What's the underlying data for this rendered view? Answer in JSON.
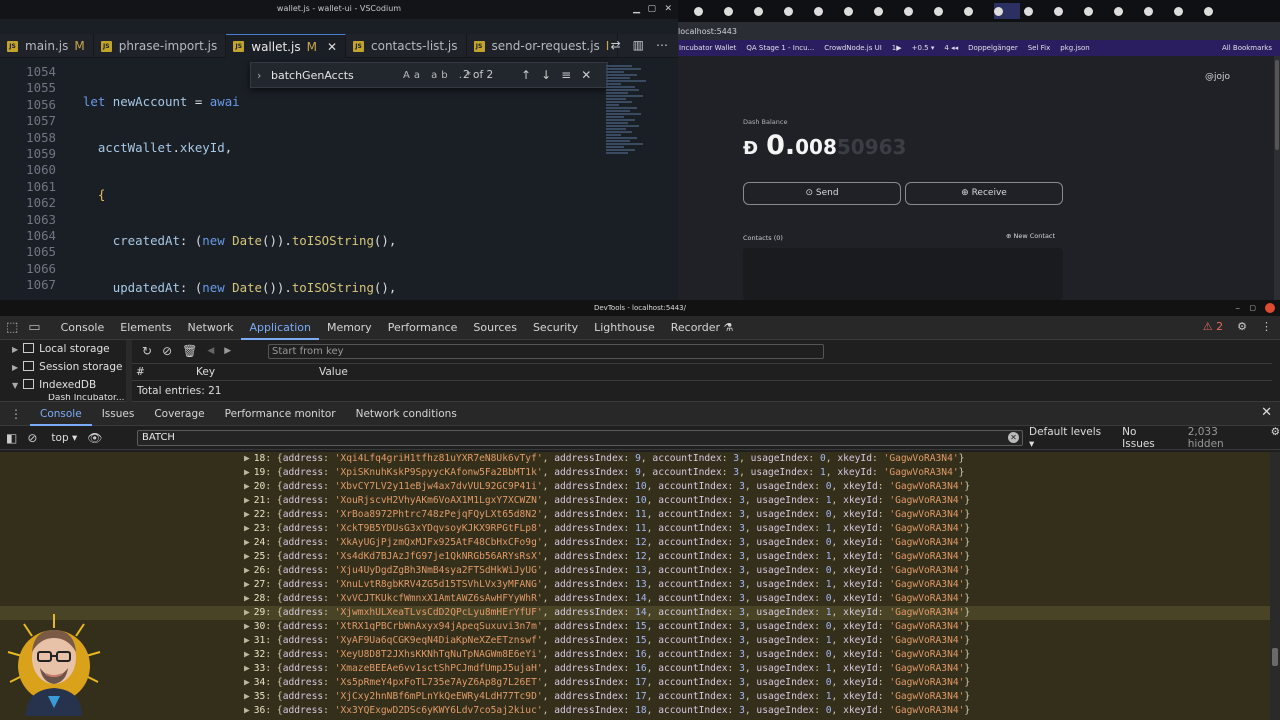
{
  "editor": {
    "window_title": "wallet.js - wallet-ui - VSCodium",
    "tabs": [
      {
        "label": "main.js",
        "mod": "M",
        "active": false
      },
      {
        "label": "phrase-import.js",
        "mod": "",
        "active": false
      },
      {
        "label": "wallet.js",
        "mod": "M",
        "active": true
      },
      {
        "label": "contacts-list.js",
        "mod": "",
        "active": false
      },
      {
        "label": "send-or-request.js",
        "mod": "I",
        "active": false
      }
    ],
    "line_numbers": [
      "1054",
      "1055",
      "1056",
      "1057",
      "1058",
      "1059",
      "1060",
      "1061",
      "1062",
      "1063",
      "1064",
      "1065",
      "1066",
      "1067"
    ],
    "find": {
      "query": "batchGenAccts",
      "options": "Aa ab .*",
      "count": "2 of 2"
    }
  },
  "browser": {
    "address": "localhost:5443",
    "bookmarks": [
      "Incubator Wallet",
      "QA Stage 1 - Incu...",
      "CrowdNode.js UI",
      "1▶",
      "+0.5 ▾",
      "4 ◂◂",
      "Doppelgänger",
      "Sel Fix",
      "pkg.json"
    ],
    "bookmarks_right": "All Bookmarks",
    "app": {
      "user": "@jojo",
      "balance_label": "Dash Balance",
      "balance_main": "0.",
      "balance_small": "008",
      "balance_dim": "50963",
      "send_label": "Send",
      "receive_label": "Receive",
      "contacts_label": "Contacts (0)",
      "new_contact_label": "New Contact"
    }
  },
  "devtools": {
    "window_title": "DevTools - localhost:5443/",
    "tabs": [
      "Console",
      "Elements",
      "Network",
      "Application",
      "Memory",
      "Performance",
      "Sources",
      "Security",
      "Lighthouse",
      "Recorder ⚗"
    ],
    "active_tab": "Application",
    "warning_count": "2",
    "sidebar": [
      "Local storage",
      "Session storage",
      "IndexedDB",
      "Dash Incubator..."
    ],
    "key_placeholder": "Start from key",
    "col_index": "#",
    "col_key": "Key",
    "col_value": "Value",
    "total_entries": "Total entries: 21",
    "drawer_tabs": [
      "Console",
      "Issues",
      "Coverage",
      "Performance monitor",
      "Network conditions"
    ],
    "context": "top",
    "console_filter": "BATCH",
    "levels": "Default levels ▾",
    "issues": "No Issues",
    "hidden": "2,033 hidden"
  },
  "console_rows": [
    {
      "i": "18",
      "addr": "Xqi4Lfq4griH1tfhz81uYXR7eN8Uk6vTyf",
      "ai": "9",
      "acc": "3",
      "ui": "0",
      "xk": "GagwVoRA3N4"
    },
    {
      "i": "19",
      "addr": "XpiSKnuhKskP9SpyycKAfonw5Fa2BbMT1k",
      "ai": "9",
      "acc": "3",
      "ui": "1",
      "xk": "GagwVoRA3N4"
    },
    {
      "i": "20",
      "addr": "XbvCY7LV2y11eBjw4ax7dvVUL92GC9P41i",
      "ai": "10",
      "acc": "3",
      "ui": "0",
      "xk": "GagwVoRA3N4"
    },
    {
      "i": "21",
      "addr": "XouRjscvH2VhyAKm6VoAX1M1LgxY7XCWZN",
      "ai": "10",
      "acc": "3",
      "ui": "1",
      "xk": "GagwVoRA3N4"
    },
    {
      "i": "22",
      "addr": "XrBoa8972Phtrc748zPejqFQyLXt65d8N2",
      "ai": "11",
      "acc": "3",
      "ui": "0",
      "xk": "GagwVoRA3N4"
    },
    {
      "i": "23",
      "addr": "XckT9B5YDUsG3xYDqvsoyKJKX9RPGtFLp8",
      "ai": "11",
      "acc": "3",
      "ui": "1",
      "xk": "GagwVoRA3N4"
    },
    {
      "i": "24",
      "addr": "XkAyUGjPjzmQxMJFx925AtF48CbHxCFo9g",
      "ai": "12",
      "acc": "3",
      "ui": "0",
      "xk": "GagwVoRA3N4"
    },
    {
      "i": "25",
      "addr": "Xs4dKd7BJAzJfG97je1QkNRGb56ARYsRsX",
      "ai": "12",
      "acc": "3",
      "ui": "1",
      "xk": "GagwVoRA3N4"
    },
    {
      "i": "26",
      "addr": "Xju4UyDgdZgBh3NmB4sya2FTSdHkWiJyUG",
      "ai": "13",
      "acc": "3",
      "ui": "0",
      "xk": "GagwVoRA3N4"
    },
    {
      "i": "27",
      "addr": "XnuLvtR8gbKRV4ZG5d15TSVhLVx3yMFANG",
      "ai": "13",
      "acc": "3",
      "ui": "1",
      "xk": "GagwVoRA3N4"
    },
    {
      "i": "28",
      "addr": "XvVCJTKUkcfWmnxX1AmtAWZ6sAwHFYyWhR",
      "ai": "14",
      "acc": "3",
      "ui": "0",
      "xk": "GagwVoRA3N4"
    },
    {
      "i": "29",
      "addr": "XjwmxhULXeaTLvsCdD2QPcLyu8mHErYfUF",
      "ai": "14",
      "acc": "3",
      "ui": "1",
      "xk": "GagwVoRA3N4"
    },
    {
      "i": "30",
      "addr": "XtRX1qPBCrbWnAxyx94jApeqSuxuvi3n7m",
      "ai": "15",
      "acc": "3",
      "ui": "0",
      "xk": "GagwVoRA3N4"
    },
    {
      "i": "31",
      "addr": "XyAF9Ua6qCGK9eqN4DiaKpNeXZeETznswf",
      "ai": "15",
      "acc": "3",
      "ui": "1",
      "xk": "GagwVoRA3N4"
    },
    {
      "i": "32",
      "addr": "XeyU8D8T2JXhsKKNhTqNuTpNAGWm8E6eYi",
      "ai": "16",
      "acc": "3",
      "ui": "0",
      "xk": "GagwVoRA3N4"
    },
    {
      "i": "33",
      "addr": "XmazeBEEAe6vv1sctShPCJmdfUmpJ5ujaH",
      "ai": "16",
      "acc": "3",
      "ui": "1",
      "xk": "GagwVoRA3N4"
    },
    {
      "i": "34",
      "addr": "Xs5pRmeY4pxFoTL735e7AyZ6Ap8g7L26ET",
      "ai": "17",
      "acc": "3",
      "ui": "0",
      "xk": "GagwVoRA3N4"
    },
    {
      "i": "35",
      "addr": "XjCxy2hnNBf6mPLnYkQeEWRy4LdH77Tc9D",
      "ai": "17",
      "acc": "3",
      "ui": "1",
      "xk": "GagwVoRA3N4"
    },
    {
      "i": "36",
      "addr": "Xx3YQExgwD2DSc6yKWY6Ldv7co5aj2kiuc",
      "ai": "18",
      "acc": "3",
      "ui": "0",
      "xk": "GagwVoRA3N4"
    }
  ],
  "colors": {
    "editor_bg": "#1a1e25",
    "console_bg": "#332f1b",
    "accent": "#7cacf8",
    "string": "#e19a69"
  }
}
